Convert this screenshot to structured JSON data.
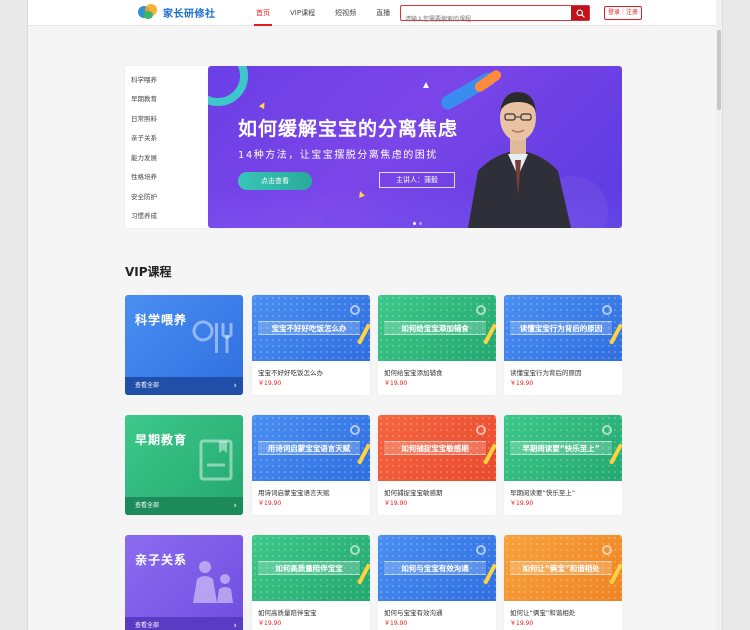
{
  "header": {
    "logo_text": "家长研修社",
    "nav": [
      "首页",
      "VIP课程",
      "短视频",
      "直播"
    ],
    "search_placeholder": "请输入您需要搜索的课程",
    "login": "登录｜注册"
  },
  "categories": [
    "科学喂养",
    "早期教育",
    "日常照料",
    "亲子关系",
    "能力发展",
    "性格培养",
    "安全防护",
    "习惯养成"
  ],
  "banner": {
    "title": "如何缓解宝宝的分离焦虑",
    "subtitle": "14种方法，让宝宝摆脱分离焦虑的困扰",
    "button": "点击查看",
    "speaker": "主讲人：蒲毅"
  },
  "vip": {
    "title": "VIP课程",
    "rows": [
      {
        "category": "科学喂养",
        "more": "查看全部",
        "courses": [
          {
            "thumb": "宝宝不好好吃饭怎么办",
            "title": "宝宝不好好吃饭怎么办",
            "price": "￥19.90"
          },
          {
            "thumb": "如何给宝宝添加辅食",
            "title": "如何给宝宝添加辅食",
            "price": "￥19.90"
          },
          {
            "thumb": "读懂宝宝行为背后的原因",
            "title": "读懂宝宝行为背后的原因",
            "price": "￥19.90"
          }
        ]
      },
      {
        "category": "早期教育",
        "more": "查看全部",
        "courses": [
          {
            "thumb": "用诗词启蒙宝宝语言天赋",
            "title": "用诗词启蒙宝宝语言天赋",
            "price": "￥19.90"
          },
          {
            "thumb": "如何捕捉宝宝敏感期",
            "title": "如何捕捉宝宝敏感期",
            "price": "￥19.90"
          },
          {
            "thumb": "早期阅读要“快乐至上”",
            "title": "早期阅读要“快乐至上”",
            "price": "￥19.90"
          }
        ]
      },
      {
        "category": "亲子关系",
        "more": "查看全部",
        "courses": [
          {
            "thumb": "如何高质量陪伴宝宝",
            "title": "如何高质量陪伴宝宝",
            "price": "￥19.90"
          },
          {
            "thumb": "如何与宝宝有效沟通",
            "title": "如何与宝宝有效沟通",
            "price": "￥19.90"
          },
          {
            "thumb": "如何让“俩宝”和谐相处",
            "title": "如何让“俩宝”和谐相处",
            "price": "￥19.90"
          }
        ]
      }
    ]
  },
  "colors": {
    "accent": "#e02020",
    "banner": "#6a3fe6"
  }
}
